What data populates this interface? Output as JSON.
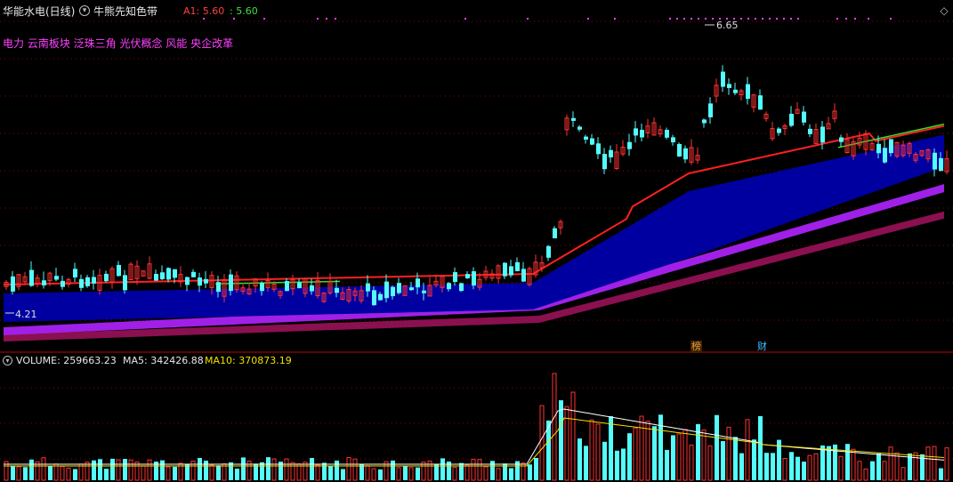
{
  "header": {
    "stock_title": "华能水电(日线)",
    "indicator_name": "牛熊先知色带",
    "a1_label": "A1: 5.60",
    "a1_value2": ": 5.60",
    "concept_tags": "电力 云南板块 泛珠三角 光伏概念 风能 央企改革"
  },
  "price_labels": {
    "high": "6.65",
    "low": "4.21"
  },
  "event_markers": {
    "bang": "榜",
    "cai": "财"
  },
  "volume_header": {
    "volume": "VOLUME: 259663.23",
    "ma5": "MA5: 342426.88",
    "ma10": "MA10: 370873.19"
  },
  "colors": {
    "up": "#ff3232",
    "down": "#54fcfc",
    "ma_red": "#ff2020",
    "ma_green": "#30e030",
    "band_blue": "#0000a0",
    "band_purple": "#a020e8",
    "band_maroon": "#8b1050",
    "tag_magenta": "#ff40ff",
    "grid": "#8b0000"
  },
  "icons": {
    "indicator_toggle": "circle-chevron-icon",
    "corner": "diamond-icon"
  },
  "chart_data": {
    "type": "candlestick",
    "period": "daily",
    "price_range": [
      4.21,
      6.65
    ],
    "max_price": 6.65,
    "min_price": 4.21,
    "last_volume": 259663.23,
    "volume_ma5": 342426.88,
    "volume_ma10": 370873.19
  }
}
